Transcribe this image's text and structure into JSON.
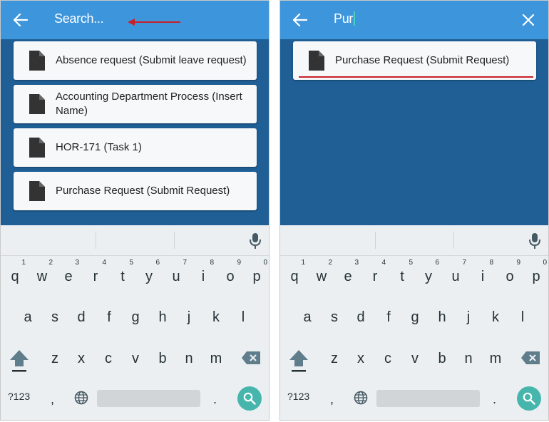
{
  "left": {
    "search_placeholder": "Search...",
    "results": [
      "Absence request (Submit leave request)",
      "Accounting Department Process (Insert Name)",
      "HOR-171 (Task 1)",
      "Purchase Request (Submit Request)"
    ]
  },
  "right": {
    "search_value": "Pur",
    "results": [
      "Purchase Request (Submit Request)"
    ]
  },
  "keyboard": {
    "row1": [
      "q",
      "w",
      "e",
      "r",
      "t",
      "y",
      "u",
      "i",
      "o",
      "p"
    ],
    "row1_hints": [
      "1",
      "2",
      "3",
      "4",
      "5",
      "6",
      "7",
      "8",
      "9",
      "0"
    ],
    "row2": [
      "a",
      "s",
      "d",
      "f",
      "g",
      "h",
      "j",
      "k",
      "l"
    ],
    "row3": [
      "z",
      "x",
      "c",
      "v",
      "b",
      "n",
      "m"
    ],
    "symbols_label": "?123",
    "comma": ",",
    "period": "."
  },
  "colors": {
    "topbar": "#3d95dc",
    "background": "#1f5f96",
    "accent_underline": "#c8202a",
    "search_key": "#46b6ac"
  },
  "icons": [
    "back-arrow-icon",
    "close-icon",
    "document-icon",
    "microphone-icon",
    "shift-icon",
    "backspace-icon",
    "globe-icon",
    "search-icon"
  ]
}
